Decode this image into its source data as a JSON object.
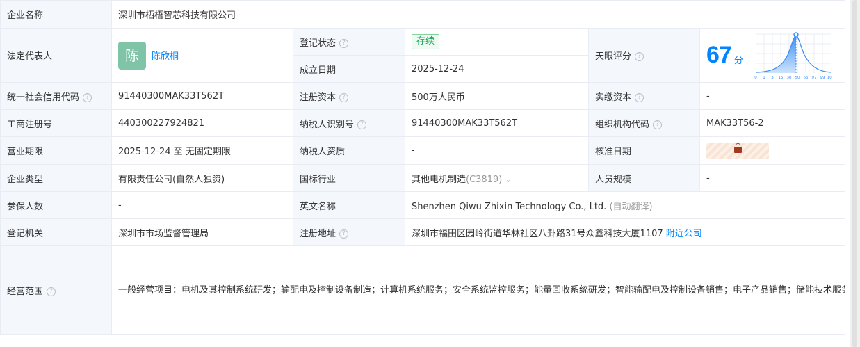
{
  "company_name": {
    "label": "企业名称",
    "value": "深圳市栖梧智芯科技有限公司"
  },
  "legal_rep": {
    "label": "法定代表人",
    "avatar_char": "陈",
    "name": "陈欣桐"
  },
  "reg_status": {
    "label": "登记状态",
    "value": "存续"
  },
  "found_date": {
    "label": "成立日期",
    "value": "2025-12-24"
  },
  "tianyan": {
    "label": "天眼评分",
    "score": "67",
    "unit": "分",
    "ticks": [
      "0",
      "1",
      "3",
      "15",
      "30",
      "50",
      "65",
      "97",
      "99",
      "100"
    ],
    "score_percentile": 0.5
  },
  "credit_code": {
    "label": "统一社会信用代码",
    "value": "91440300MAK33T562T"
  },
  "reg_capital": {
    "label": "注册资本",
    "value": "500万人民币"
  },
  "paid_capital": {
    "label": "实缴资本",
    "value": "-"
  },
  "biz_reg_no": {
    "label": "工商注册号",
    "value": "440300227924821"
  },
  "taxpayer_id": {
    "label": "纳税人识别号",
    "value": "91440300MAK33T562T"
  },
  "org_code": {
    "label": "组织机构代码",
    "value": "MAK33T56-2"
  },
  "term": {
    "label": "营业期限",
    "value": "2025-12-24 至 无固定期限"
  },
  "taxpayer_qual": {
    "label": "纳税人资质",
    "value": "-"
  },
  "approval_date": {
    "label": "核准日期"
  },
  "company_type": {
    "label": "企业类型",
    "value": "有限责任公司(自然人独资)"
  },
  "industry": {
    "label": "国标行业",
    "value": "其他电机制造",
    "code": "(C3819)"
  },
  "staff_size": {
    "label": "人员规模",
    "value": "-"
  },
  "insured": {
    "label": "参保人数",
    "value": "-"
  },
  "english_name": {
    "label": "英文名称",
    "value": "Shenzhen Qiwu Zhixin Technology Co., Ltd.",
    "note": "(自动翻译)"
  },
  "reg_authority": {
    "label": "登记机关",
    "value": "深圳市市场监督管理局"
  },
  "reg_address": {
    "label": "注册地址",
    "value": "深圳市福田区园岭街道华林社区八卦路31号众鑫科技大厦1107",
    "link": "附近公司"
  },
  "scope": {
    "label": "经营范围",
    "value": "一般经营项目：电机及其控制系统研发；输配电及控制设备制造；计算机系统服务；安全系统监控服务；能量回收系统研发；智能输配电及控制设备销售；电子产品销售；储能技术服务；数字视频监控系统制造；数字视频监控系统销售；集成电路制造；集成电路销售；智能控制系统集成；集成电路芯片及产品制造；集成电路芯片及产品销售；新兴软件和新型信息技术服务；人工智能公共数据平台；人工智能公共服务平台技术咨询服务；人工智能双创服务平台；人工智能基础软件开发；软件开发；集成电路设计；技术服务、技术开发、技术咨询、技术交流、技术转让、技术推广；以自有资金从事投资活动。（除依法须经批准的项目外，凭营业执照依法自主开展经营活动）许可经营项目：无。"
  },
  "colors": {
    "label_bg": "#f4f7fc",
    "border": "#e9ecf3",
    "link": "#0084ff",
    "status_green": "#20a45a"
  }
}
